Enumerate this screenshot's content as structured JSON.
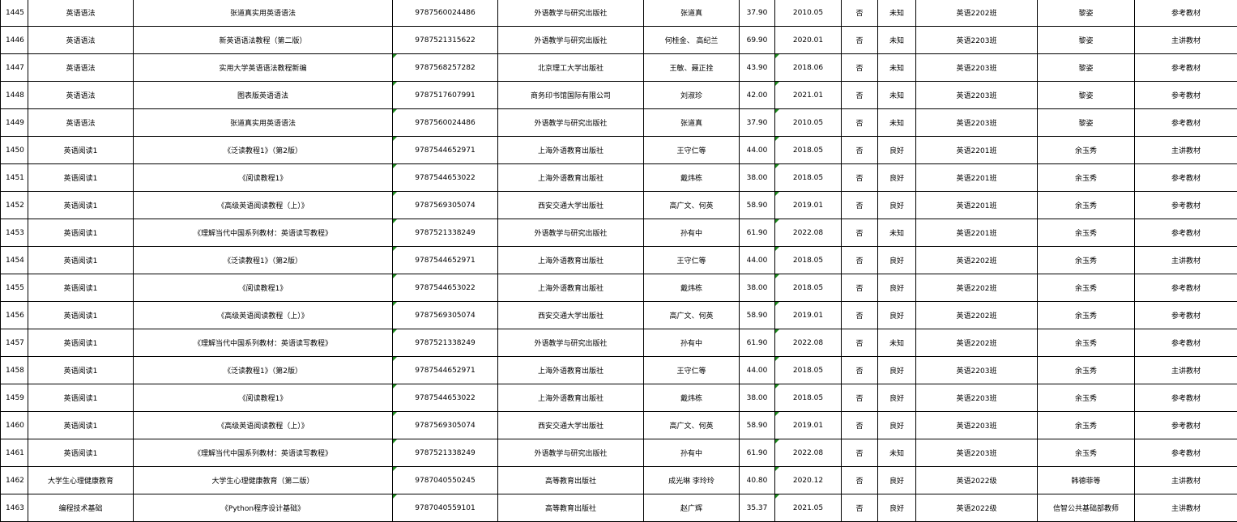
{
  "rows": [
    [
      "1445",
      "英语语法",
      "张道真实用英语语法",
      "9787560024486",
      "外语教学与研究出版社",
      "张道真",
      "37.90",
      "2010.05",
      "否",
      "未知",
      "英语2202班",
      "黎姿",
      "参考教材"
    ],
    [
      "1446",
      "英语语法",
      "新英语语法教程（第二版）",
      "9787521315622",
      "外语教学与研究出版社",
      "何桂金、 高纪兰",
      "69.90",
      "2020.01",
      "否",
      "未知",
      "英语2203班",
      "黎姿",
      "主讲教材"
    ],
    [
      "1447",
      "英语语法",
      "实用大学英语语法教程新编",
      "9787568257282",
      "北京理工大学出版社",
      "王敏、聂正拴",
      "43.90",
      "2018.06",
      "否",
      "未知",
      "英语2203班",
      "黎姿",
      "参考教材"
    ],
    [
      "1448",
      "英语语法",
      "图表版英语语法",
      "9787517607991",
      "商务印书馆国际有限公司",
      "刘淑珍",
      "42.00",
      "2021.01",
      "否",
      "未知",
      "英语2203班",
      "黎姿",
      "参考教材"
    ],
    [
      "1449",
      "英语语法",
      "张道真实用英语语法",
      "9787560024486",
      "外语教学与研究出版社",
      "张道真",
      "37.90",
      "2010.05",
      "否",
      "未知",
      "英语2203班",
      "黎姿",
      "参考教材"
    ],
    [
      "1450",
      "英语阅读1",
      "《泛读教程1》（第2版）",
      "9787544652971",
      "上海外语教育出版社",
      "王守仁等",
      "44.00",
      "2018.05",
      "否",
      "良好",
      "英语2201班",
      "余玉秀",
      "主讲教材"
    ],
    [
      "1451",
      "英语阅读1",
      "《阅读教程1》",
      "9787544653022",
      "上海外语教育出版社",
      "戴炜栋",
      "38.00",
      "2018.05",
      "否",
      "良好",
      "英语2201班",
      "余玉秀",
      "参考教材"
    ],
    [
      "1452",
      "英语阅读1",
      "《高级英语阅读教程（上）》",
      "9787569305074",
      "西安交通大学出版社",
      "高广文、何英",
      "58.90",
      "2019.01",
      "否",
      "良好",
      "英语2201班",
      "余玉秀",
      "参考教材"
    ],
    [
      "1453",
      "英语阅读1",
      "《理解当代中国系列教材：英语读写教程》",
      "9787521338249",
      "外语教学与研究出版社",
      "孙有中",
      "61.90",
      "2022.08",
      "否",
      "未知",
      "英语2201班",
      "余玉秀",
      "参考教材"
    ],
    [
      "1454",
      "英语阅读1",
      "《泛读教程1》（第2版）",
      "9787544652971",
      "上海外语教育出版社",
      "王守仁等",
      "44.00",
      "2018.05",
      "否",
      "良好",
      "英语2202班",
      "余玉秀",
      "主讲教材"
    ],
    [
      "1455",
      "英语阅读1",
      "《阅读教程1》",
      "9787544653022",
      "上海外语教育出版社",
      "戴炜栋",
      "38.00",
      "2018.05",
      "否",
      "良好",
      "英语2202班",
      "余玉秀",
      "参考教材"
    ],
    [
      "1456",
      "英语阅读1",
      "《高级英语阅读教程（上）》",
      "9787569305074",
      "西安交通大学出版社",
      "高广文、何英",
      "58.90",
      "2019.01",
      "否",
      "良好",
      "英语2202班",
      "余玉秀",
      "参考教材"
    ],
    [
      "1457",
      "英语阅读1",
      "《理解当代中国系列教材：英语读写教程》",
      "9787521338249",
      "外语教学与研究出版社",
      "孙有中",
      "61.90",
      "2022.08",
      "否",
      "未知",
      "英语2202班",
      "余玉秀",
      "参考教材"
    ],
    [
      "1458",
      "英语阅读1",
      "《泛读教程1》（第2版）",
      "9787544652971",
      "上海外语教育出版社",
      "王守仁等",
      "44.00",
      "2018.05",
      "否",
      "良好",
      "英语2203班",
      "余玉秀",
      "主讲教材"
    ],
    [
      "1459",
      "英语阅读1",
      "《阅读教程1》",
      "9787544653022",
      "上海外语教育出版社",
      "戴炜栋",
      "38.00",
      "2018.05",
      "否",
      "良好",
      "英语2203班",
      "余玉秀",
      "参考教材"
    ],
    [
      "1460",
      "英语阅读1",
      "《高级英语阅读教程（上）》",
      "9787569305074",
      "西安交通大学出版社",
      "高广文、何英",
      "58.90",
      "2019.01",
      "否",
      "良好",
      "英语2203班",
      "余玉秀",
      "参考教材"
    ],
    [
      "1461",
      "英语阅读1",
      "《理解当代中国系列教材：英语读写教程》",
      "9787521338249",
      "外语教学与研究出版社",
      "孙有中",
      "61.90",
      "2022.08",
      "否",
      "未知",
      "英语2203班",
      "余玉秀",
      "参考教材"
    ],
    [
      "1462",
      "大学生心理健康教育",
      "大学生心理健康教育（第二版）",
      "9787040550245",
      "高等教育出版社",
      "成光琳 李玲玲",
      "40.80",
      "2020.12",
      "否",
      "良好",
      "英语2022级",
      "韩德菲等",
      "主讲教材"
    ],
    [
      "1463",
      "编程技术基础",
      "《Python程序设计基础》",
      "9787040559101",
      "高等教育出版社",
      "赵广辉",
      "35.37",
      "2021.05",
      "否",
      "良好",
      "英语2022级",
      "信智公共基础部教师",
      "主讲教材"
    ]
  ]
}
